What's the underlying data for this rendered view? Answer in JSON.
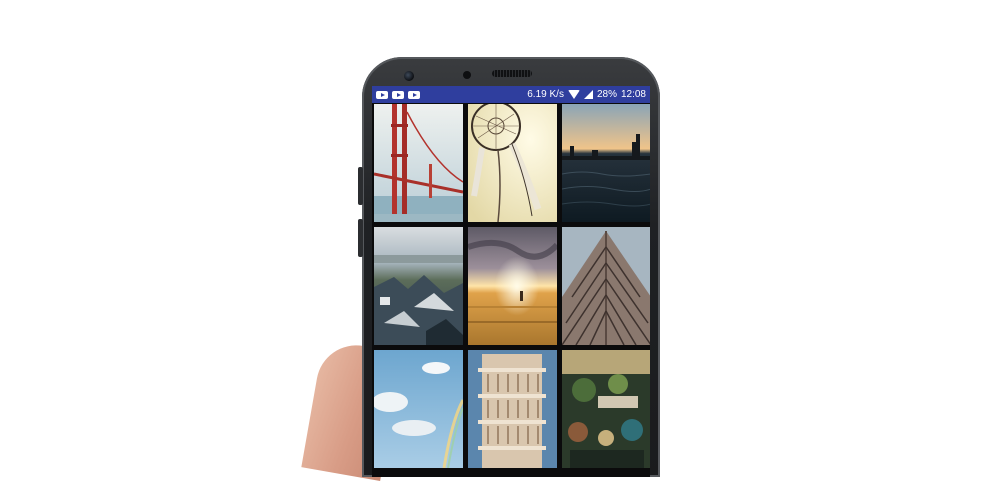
{
  "status_bar": {
    "notification_icons": [
      "youtube-icon",
      "youtube-icon",
      "youtube-icon"
    ],
    "network_speed": "6.19 K/s",
    "battery": "28%",
    "time": "12:08"
  },
  "gallery": {
    "photos": [
      {
        "subject": "golden-gate-bridge"
      },
      {
        "subject": "dreamcatcher"
      },
      {
        "subject": "city-skyline-over-water"
      },
      {
        "subject": "rooftops-town"
      },
      {
        "subject": "sunset-field"
      },
      {
        "subject": "building-facade"
      },
      {
        "subject": "sky-rainbow"
      },
      {
        "subject": "leaning-tower"
      },
      {
        "subject": "food-market"
      }
    ]
  },
  "colors": {
    "status_bar": "#2f3e9e",
    "phone_body": "#1f2124"
  }
}
